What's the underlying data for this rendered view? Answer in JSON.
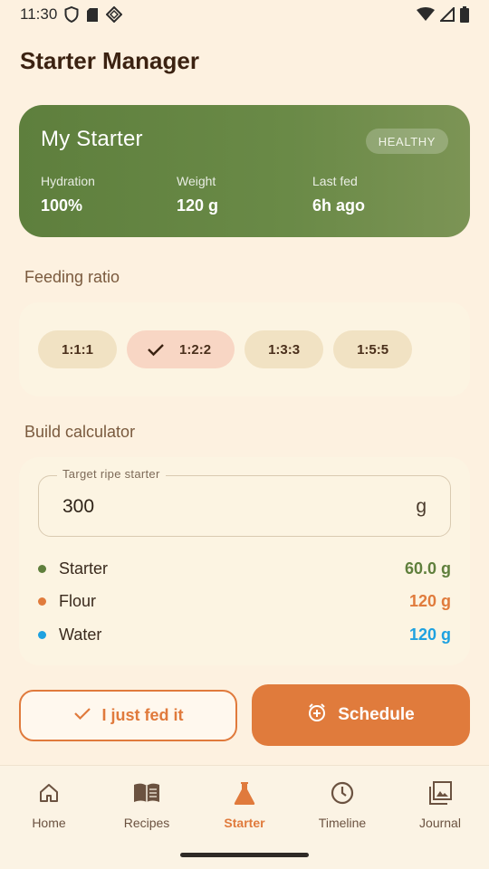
{
  "status_bar": {
    "time": "11:30",
    "icons": [
      "shield-icon",
      "sd-card-icon",
      "diamond-icon",
      "wifi-icon",
      "signal-icon",
      "battery-icon"
    ]
  },
  "page": {
    "title": "Starter Manager"
  },
  "starter": {
    "name": "My Starter",
    "badge": "HEALTHY",
    "stats": [
      {
        "label": "Hydration",
        "value": "100%"
      },
      {
        "label": "Weight",
        "value": "120 g"
      },
      {
        "label": "Last fed",
        "value": "6h ago"
      }
    ],
    "colors": {
      "card_start": "#5e7f3d",
      "card_end": "#7c9455"
    }
  },
  "feeding": {
    "title": "Feeding ratio",
    "options": [
      {
        "label": "1:1:1",
        "selected": false
      },
      {
        "label": "1:2:2",
        "selected": true
      },
      {
        "label": "1:3:3",
        "selected": false
      },
      {
        "label": "1:5:5",
        "selected": false
      }
    ]
  },
  "calculator": {
    "title": "Build calculator",
    "target_label": "Target ripe starter",
    "target_value": "300",
    "target_unit": "g",
    "ingredients": [
      {
        "name": "Starter",
        "amount": "60.0 g",
        "color": "#5f7f3c"
      },
      {
        "name": "Flour",
        "amount": "120 g",
        "color": "#e07b3c"
      },
      {
        "name": "Water",
        "amount": "120 g",
        "color": "#1ea1e0"
      }
    ]
  },
  "actions": {
    "fed_label": "I just fed it",
    "schedule_label": "Schedule",
    "accent": "#e07b3c"
  },
  "nav": {
    "items": [
      {
        "label": "Home",
        "icon": "home-icon",
        "active": false
      },
      {
        "label": "Recipes",
        "icon": "book-icon",
        "active": false
      },
      {
        "label": "Starter",
        "icon": "flask-icon",
        "active": true
      },
      {
        "label": "Timeline",
        "icon": "clock-icon",
        "active": false
      },
      {
        "label": "Journal",
        "icon": "photo-album-icon",
        "active": false
      }
    ]
  }
}
